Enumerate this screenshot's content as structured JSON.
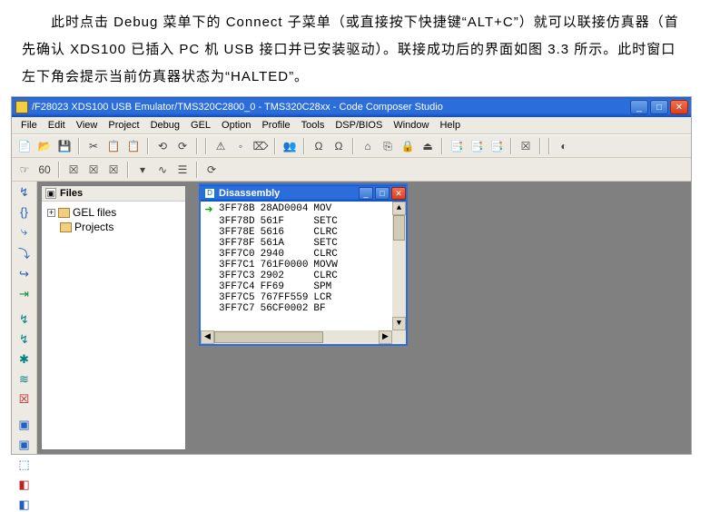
{
  "doc": {
    "para": "　　此时点击 Debug 菜单下的 Connect 子菜单（或直接按下快捷键“ALT+C”）就可以联接仿真器（首先确认 XDS100 已插入 PC 机 USB 接口并已安装驱动）。联接成功后的界面如图 3.3 所示。此时窗口左下角会提示当前仿真器状态为“HALTED”。"
  },
  "window": {
    "title": "/F28023 XDS100 USB Emulator/TMS320C2800_0 - TMS320C28xx - Code Composer Studio",
    "minimize": "_",
    "maximize": "□",
    "close": "✕"
  },
  "menu": {
    "items": [
      "File",
      "Edit",
      "View",
      "Project",
      "Debug",
      "GEL",
      "Option",
      "Profile",
      "Tools",
      "DSP/BIOS",
      "Window",
      "Help"
    ]
  },
  "toolbar1": {
    "icons": [
      "📄",
      "📂",
      "💾",
      "",
      "✂",
      "📋",
      "📋",
      "",
      "⟲",
      "⟳",
      "",
      "",
      "⚠",
      "◦",
      "⌦",
      "",
      "👥",
      "",
      "Ω",
      "Ω",
      "",
      "⌂",
      "⎘",
      "🔒",
      "⏏",
      "",
      "📑",
      "📑",
      "📑",
      "",
      "☒",
      "",
      "",
      "◐"
    ]
  },
  "toolbar2": {
    "icons": [
      "☞",
      "60",
      "",
      "☒",
      "☒",
      "☒",
      "",
      "▾",
      "∿",
      "☰",
      "",
      "⟳"
    ]
  },
  "filepanel": {
    "pm": "▣",
    "label": "Files",
    "tree": [
      {
        "pm": "+",
        "label": "GEL files"
      },
      {
        "pm": "",
        "label": "Projects"
      }
    ]
  },
  "vbar": {
    "icons": [
      {
        "g": "↯",
        "c": ""
      },
      {
        "g": "{}",
        "c": ""
      },
      {
        "g": "⤷",
        "c": ""
      },
      {
        "g": "⤵",
        "c": ""
      },
      {
        "g": "↪",
        "c": ""
      },
      {
        "g": "⇥",
        "c": "green"
      },
      {
        "g": "",
        "c": ""
      },
      {
        "g": "↯",
        "c": "teal"
      },
      {
        "g": "↯",
        "c": "teal"
      },
      {
        "g": "✱",
        "c": "teal"
      },
      {
        "g": "≋",
        "c": "teal"
      },
      {
        "g": "☒",
        "c": "red"
      },
      {
        "g": "",
        "c": ""
      },
      {
        "g": "▣",
        "c": ""
      },
      {
        "g": "▣",
        "c": ""
      },
      {
        "g": "⬚",
        "c": ""
      },
      {
        "g": "◧",
        "c": "red"
      },
      {
        "g": "◧",
        "c": ""
      }
    ]
  },
  "disasm": {
    "title": "Disassembly",
    "min": "_",
    "max": "□",
    "close": "✕",
    "lines": [
      {
        "pc": "➜",
        "addr": "3FF78B",
        "opc": "28AD0004",
        "mn": "MOV"
      },
      {
        "pc": "",
        "addr": "3FF78D",
        "opc": "561F",
        "mn": "SETC"
      },
      {
        "pc": "",
        "addr": "3FF78E",
        "opc": "5616",
        "mn": "CLRC"
      },
      {
        "pc": "",
        "addr": "3FF78F",
        "opc": "561A",
        "mn": "SETC"
      },
      {
        "pc": "",
        "addr": "3FF7C0",
        "opc": "2940",
        "mn": "CLRC"
      },
      {
        "pc": "",
        "addr": "3FF7C1",
        "opc": "761F0000",
        "mn": "MOVW"
      },
      {
        "pc": "",
        "addr": "3FF7C3",
        "opc": "2902",
        "mn": "CLRC"
      },
      {
        "pc": "",
        "addr": "3FF7C4",
        "opc": "FF69",
        "mn": "SPM"
      },
      {
        "pc": "",
        "addr": "3FF7C5",
        "opc": "767FF559",
        "mn": "LCR"
      },
      {
        "pc": "",
        "addr": "3FF7C7",
        "opc": "56CF0002",
        "mn": "BF"
      }
    ],
    "scroll_up": "▲",
    "scroll_down": "▼",
    "scroll_left": "◀",
    "scroll_right": "▶"
  }
}
